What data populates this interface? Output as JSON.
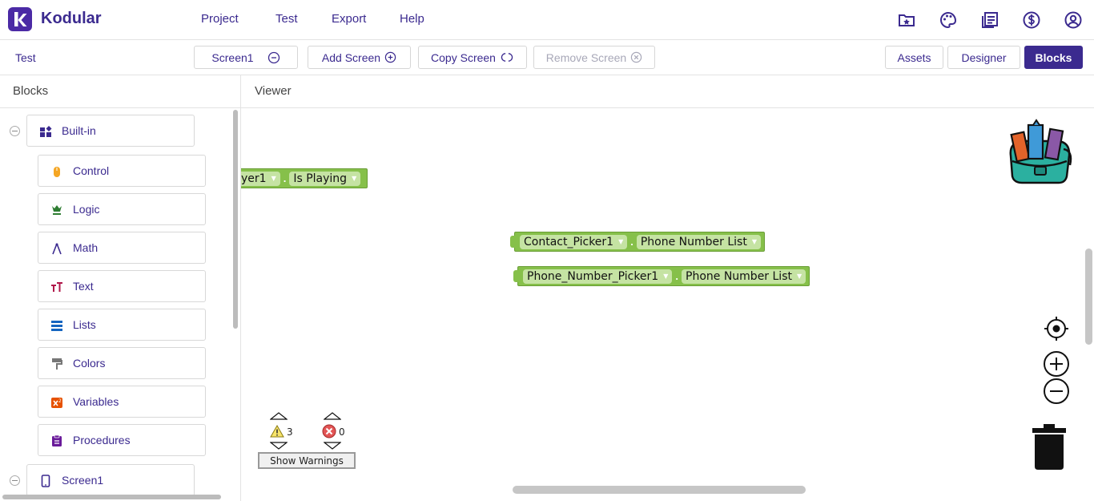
{
  "app": {
    "brand": "Kodular",
    "colors": {
      "accent": "#3b2a8f",
      "block_green": "#86c04a"
    }
  },
  "topnav": {
    "menu": [
      "Project",
      "Test",
      "Export",
      "Help"
    ],
    "icons": [
      "folder-star-icon",
      "palette-icon",
      "news-icon",
      "dollar-icon",
      "account-icon"
    ]
  },
  "toolbar": {
    "project_name": "Test",
    "screen_select": "Screen1",
    "add_screen": "Add Screen",
    "copy_screen": "Copy Screen",
    "remove_screen": "Remove Screen",
    "assets": "Assets",
    "designer": "Designer",
    "blocks": "Blocks"
  },
  "blocks_panel": {
    "title": "Blocks",
    "builtin_label": "Built-in",
    "categories": [
      {
        "label": "Control",
        "icon": "control-icon",
        "color": "#f5a623"
      },
      {
        "label": "Logic",
        "icon": "logic-icon",
        "color": "#2e7d32"
      },
      {
        "label": "Math",
        "icon": "math-icon",
        "color": "#3b2a8f"
      },
      {
        "label": "Text",
        "icon": "text-icon",
        "color": "#b0174a"
      },
      {
        "label": "Lists",
        "icon": "lists-icon",
        "color": "#1565c0"
      },
      {
        "label": "Colors",
        "icon": "colors-icon",
        "color": "#777777"
      },
      {
        "label": "Variables",
        "icon": "variables-icon",
        "color": "#e65100"
      },
      {
        "label": "Procedures",
        "icon": "procedures-icon",
        "color": "#6a1b9a"
      }
    ],
    "screen_label": "Screen1"
  },
  "viewer": {
    "title": "Viewer",
    "blocks": [
      {
        "component": "yer1",
        "property": "Is Playing"
      },
      {
        "component": "Contact_Picker1",
        "property": "Phone Number List"
      },
      {
        "component": "Phone_Number_Picker1",
        "property": "Phone Number List"
      }
    ],
    "separator": ".",
    "warnings_count": "3",
    "errors_count": "0",
    "show_warnings": "Show Warnings"
  }
}
